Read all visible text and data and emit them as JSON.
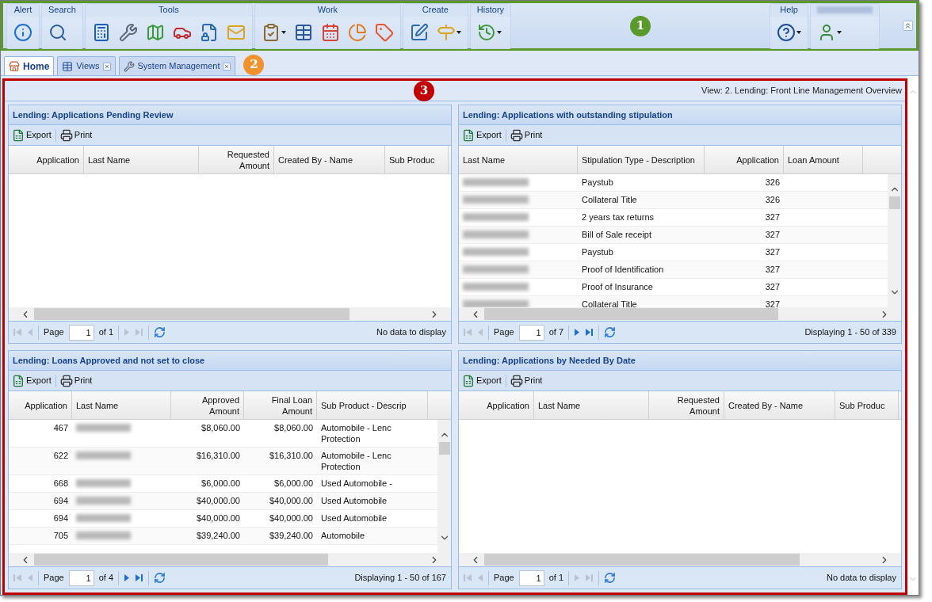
{
  "toolbar": {
    "callout": {
      "label": "1",
      "color": "#5a9a2a"
    },
    "groups": [
      {
        "title": "Alert",
        "icons": [
          {
            "kind": "info",
            "dropdown": false
          }
        ]
      },
      {
        "title": "Search",
        "icons": [
          {
            "kind": "search",
            "dropdown": false
          }
        ]
      },
      {
        "title": "Tools",
        "icons": [
          {
            "kind": "calculator",
            "dropdown": false
          },
          {
            "kind": "wrench",
            "dropdown": false
          },
          {
            "kind": "map",
            "dropdown": false
          },
          {
            "kind": "car",
            "dropdown": false
          },
          {
            "kind": "lock",
            "dropdown": false
          },
          {
            "kind": "mail",
            "dropdown": false
          }
        ]
      },
      {
        "title": "Work",
        "icons": [
          {
            "kind": "clipboard",
            "dropdown": true
          },
          {
            "kind": "table",
            "dropdown": false
          },
          {
            "kind": "calendar",
            "dropdown": false
          },
          {
            "kind": "pie",
            "dropdown": false
          },
          {
            "kind": "tag",
            "dropdown": false
          }
        ]
      },
      {
        "title": "Create",
        "icons": [
          {
            "kind": "edit",
            "dropdown": false
          },
          {
            "kind": "signpost",
            "dropdown": true
          }
        ]
      },
      {
        "title": "History",
        "icons": [
          {
            "kind": "history",
            "dropdown": true
          }
        ]
      }
    ],
    "right_groups": [
      {
        "title": "Help",
        "icons": [
          {
            "kind": "help",
            "dropdown": true
          }
        ]
      },
      {
        "title_redacted": true,
        "icons": [
          {
            "kind": "user",
            "dropdown": true
          }
        ]
      }
    ]
  },
  "tabs": {
    "callout": {
      "label": "2",
      "color": "#f0922e"
    },
    "items": [
      {
        "label": "Home",
        "kind": "home",
        "selected": true,
        "closable": false
      },
      {
        "label": "Views",
        "kind": "table",
        "selected": false,
        "closable": true
      },
      {
        "label": "System Management",
        "kind": "wrench",
        "selected": false,
        "closable": true
      }
    ]
  },
  "content": {
    "callout": {
      "label": "3",
      "color": "#c00000"
    },
    "view_label": "View: 2. Lending: Front Line Management Overview",
    "panels": [
      {
        "title": "Lending: Applications Pending Review",
        "export": "Export",
        "print": "Print",
        "vscroll": false,
        "columns": [
          {
            "label": "Application",
            "numeric": true
          },
          {
            "label": "Last Name",
            "numeric": false
          },
          {
            "label": "Requested Amount",
            "numeric": true
          },
          {
            "label": "Created By - Name",
            "numeric": false
          },
          {
            "label": "Sub Produc",
            "numeric": false
          }
        ],
        "pager": {
          "page_label": "Page",
          "page": "1",
          "of": "of 1",
          "status": "No data to display",
          "has_next": false
        }
      },
      {
        "title": "Lending: Applications with outstanding stipulation",
        "export": "Export",
        "print": "Print",
        "vscroll": true,
        "columns": [
          {
            "label": "Last Name",
            "numeric": false
          },
          {
            "label": "Stipulation Type - Description",
            "numeric": false
          },
          {
            "label": "Application",
            "numeric": true
          },
          {
            "label": "Loan Amount",
            "numeric": false
          }
        ],
        "rows": [
          [
            {
              "kind": "redacted"
            },
            "Paystub",
            "326",
            ""
          ],
          [
            {
              "kind": "redacted"
            },
            "Collateral Title",
            "326",
            ""
          ],
          [
            {
              "kind": "redacted"
            },
            "2 years tax returns",
            "327",
            ""
          ],
          [
            {
              "kind": "redacted"
            },
            "Bill of Sale receipt",
            "327",
            ""
          ],
          [
            {
              "kind": "redacted"
            },
            "Paystub",
            "327",
            ""
          ],
          [
            {
              "kind": "redacted"
            },
            "Proof of Identification",
            "327",
            ""
          ],
          [
            {
              "kind": "redacted"
            },
            "Proof of Insurance",
            "327",
            ""
          ],
          [
            {
              "kind": "redacted"
            },
            "Collateral Title",
            "327",
            ""
          ]
        ],
        "pager": {
          "page_label": "Page",
          "page": "1",
          "of": "of 7",
          "status": "Displaying 1 - 50 of 339",
          "has_next": true
        }
      },
      {
        "title": "Lending: Loans Approved and not set to close",
        "export": "Export",
        "print": "Print",
        "vscroll": true,
        "columns": [
          {
            "label": "Application",
            "numeric": true
          },
          {
            "label": "Last Name",
            "numeric": false
          },
          {
            "label": "Approved Amount",
            "numeric": true
          },
          {
            "label": "Final Loan Amount",
            "numeric": true
          },
          {
            "label": "Sub Product - Descrip",
            "numeric": false
          }
        ],
        "rows": [
          [
            "467",
            {
              "kind": "redacted"
            },
            "$8,060.00",
            "$8,060.00",
            "Automobile - Lenc\nProtection"
          ],
          [
            "622",
            {
              "kind": "redacted"
            },
            "$16,310.00",
            "$16,310.00",
            "Automobile - Lenc\nProtection"
          ],
          [
            "668",
            {
              "kind": "redacted"
            },
            "$6,000.00",
            "$6,000.00",
            "Used Automobile -"
          ],
          [
            "694",
            {
              "kind": "redacted"
            },
            "$40,000.00",
            "$40,000.00",
            "Used Automobile"
          ],
          [
            "694",
            {
              "kind": "redacted"
            },
            "$40,000.00",
            "$40,000.00",
            "Used Automobile"
          ],
          [
            "705",
            {
              "kind": "redacted"
            },
            "$39,240.00",
            "$39,240.00",
            "Automobile"
          ]
        ],
        "pager": {
          "page_label": "Page",
          "page": "1",
          "of": "of 4",
          "status": "Displaying 1 - 50 of 167",
          "has_next": true
        }
      },
      {
        "title": "Lending: Applications by Needed By Date",
        "export": "Export",
        "print": "Print",
        "vscroll": false,
        "columns": [
          {
            "label": "Application",
            "numeric": true
          },
          {
            "label": "Last Name",
            "numeric": false
          },
          {
            "label": "Requested Amount",
            "numeric": true
          },
          {
            "label": "Created By - Name",
            "numeric": false
          },
          {
            "label": "Sub Produc",
            "numeric": false
          }
        ],
        "pager": {
          "page_label": "Page",
          "page": "1",
          "of": "of 1",
          "status": "No data to display",
          "has_next": false
        }
      }
    ]
  }
}
